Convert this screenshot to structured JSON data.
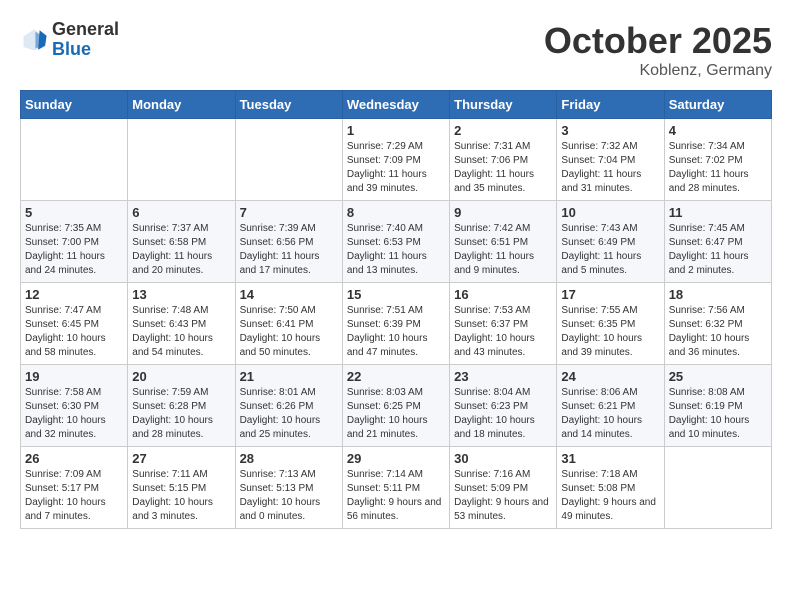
{
  "header": {
    "logo_general": "General",
    "logo_blue": "Blue",
    "month_title": "October 2025",
    "subtitle": "Koblenz, Germany"
  },
  "weekdays": [
    "Sunday",
    "Monday",
    "Tuesday",
    "Wednesday",
    "Thursday",
    "Friday",
    "Saturday"
  ],
  "weeks": [
    [
      {
        "day": "",
        "content": ""
      },
      {
        "day": "",
        "content": ""
      },
      {
        "day": "",
        "content": ""
      },
      {
        "day": "1",
        "content": "Sunrise: 7:29 AM\nSunset: 7:09 PM\nDaylight: 11 hours\nand 39 minutes."
      },
      {
        "day": "2",
        "content": "Sunrise: 7:31 AM\nSunset: 7:06 PM\nDaylight: 11 hours\nand 35 minutes."
      },
      {
        "day": "3",
        "content": "Sunrise: 7:32 AM\nSunset: 7:04 PM\nDaylight: 11 hours\nand 31 minutes."
      },
      {
        "day": "4",
        "content": "Sunrise: 7:34 AM\nSunset: 7:02 PM\nDaylight: 11 hours\nand 28 minutes."
      }
    ],
    [
      {
        "day": "5",
        "content": "Sunrise: 7:35 AM\nSunset: 7:00 PM\nDaylight: 11 hours\nand 24 minutes."
      },
      {
        "day": "6",
        "content": "Sunrise: 7:37 AM\nSunset: 6:58 PM\nDaylight: 11 hours\nand 20 minutes."
      },
      {
        "day": "7",
        "content": "Sunrise: 7:39 AM\nSunset: 6:56 PM\nDaylight: 11 hours\nand 17 minutes."
      },
      {
        "day": "8",
        "content": "Sunrise: 7:40 AM\nSunset: 6:53 PM\nDaylight: 11 hours\nand 13 minutes."
      },
      {
        "day": "9",
        "content": "Sunrise: 7:42 AM\nSunset: 6:51 PM\nDaylight: 11 hours\nand 9 minutes."
      },
      {
        "day": "10",
        "content": "Sunrise: 7:43 AM\nSunset: 6:49 PM\nDaylight: 11 hours\nand 5 minutes."
      },
      {
        "day": "11",
        "content": "Sunrise: 7:45 AM\nSunset: 6:47 PM\nDaylight: 11 hours\nand 2 minutes."
      }
    ],
    [
      {
        "day": "12",
        "content": "Sunrise: 7:47 AM\nSunset: 6:45 PM\nDaylight: 10 hours\nand 58 minutes."
      },
      {
        "day": "13",
        "content": "Sunrise: 7:48 AM\nSunset: 6:43 PM\nDaylight: 10 hours\nand 54 minutes."
      },
      {
        "day": "14",
        "content": "Sunrise: 7:50 AM\nSunset: 6:41 PM\nDaylight: 10 hours\nand 50 minutes."
      },
      {
        "day": "15",
        "content": "Sunrise: 7:51 AM\nSunset: 6:39 PM\nDaylight: 10 hours\nand 47 minutes."
      },
      {
        "day": "16",
        "content": "Sunrise: 7:53 AM\nSunset: 6:37 PM\nDaylight: 10 hours\nand 43 minutes."
      },
      {
        "day": "17",
        "content": "Sunrise: 7:55 AM\nSunset: 6:35 PM\nDaylight: 10 hours\nand 39 minutes."
      },
      {
        "day": "18",
        "content": "Sunrise: 7:56 AM\nSunset: 6:32 PM\nDaylight: 10 hours\nand 36 minutes."
      }
    ],
    [
      {
        "day": "19",
        "content": "Sunrise: 7:58 AM\nSunset: 6:30 PM\nDaylight: 10 hours\nand 32 minutes."
      },
      {
        "day": "20",
        "content": "Sunrise: 7:59 AM\nSunset: 6:28 PM\nDaylight: 10 hours\nand 28 minutes."
      },
      {
        "day": "21",
        "content": "Sunrise: 8:01 AM\nSunset: 6:26 PM\nDaylight: 10 hours\nand 25 minutes."
      },
      {
        "day": "22",
        "content": "Sunrise: 8:03 AM\nSunset: 6:25 PM\nDaylight: 10 hours\nand 21 minutes."
      },
      {
        "day": "23",
        "content": "Sunrise: 8:04 AM\nSunset: 6:23 PM\nDaylight: 10 hours\nand 18 minutes."
      },
      {
        "day": "24",
        "content": "Sunrise: 8:06 AM\nSunset: 6:21 PM\nDaylight: 10 hours\nand 14 minutes."
      },
      {
        "day": "25",
        "content": "Sunrise: 8:08 AM\nSunset: 6:19 PM\nDaylight: 10 hours\nand 10 minutes."
      }
    ],
    [
      {
        "day": "26",
        "content": "Sunrise: 7:09 AM\nSunset: 5:17 PM\nDaylight: 10 hours\nand 7 minutes."
      },
      {
        "day": "27",
        "content": "Sunrise: 7:11 AM\nSunset: 5:15 PM\nDaylight: 10 hours\nand 3 minutes."
      },
      {
        "day": "28",
        "content": "Sunrise: 7:13 AM\nSunset: 5:13 PM\nDaylight: 10 hours\nand 0 minutes."
      },
      {
        "day": "29",
        "content": "Sunrise: 7:14 AM\nSunset: 5:11 PM\nDaylight: 9 hours\nand 56 minutes."
      },
      {
        "day": "30",
        "content": "Sunrise: 7:16 AM\nSunset: 5:09 PM\nDaylight: 9 hours\nand 53 minutes."
      },
      {
        "day": "31",
        "content": "Sunrise: 7:18 AM\nSunset: 5:08 PM\nDaylight: 9 hours\nand 49 minutes."
      },
      {
        "day": "",
        "content": ""
      }
    ]
  ]
}
